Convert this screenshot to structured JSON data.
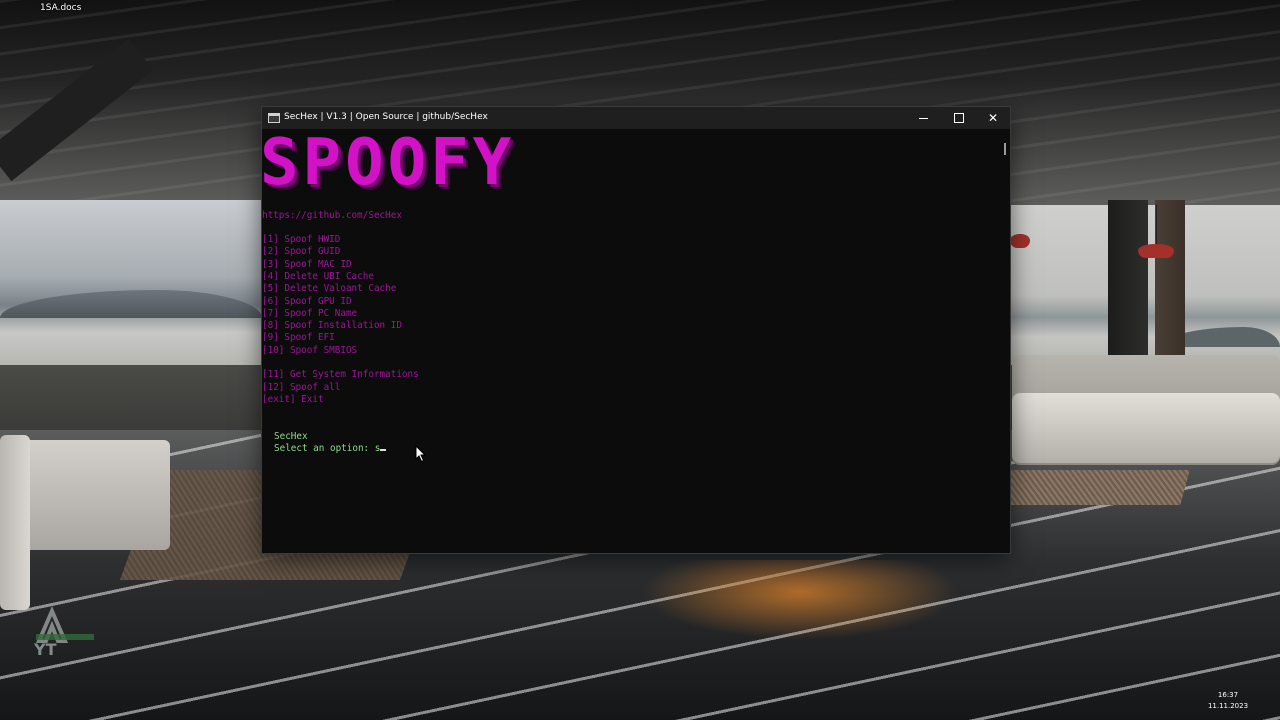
{
  "desktop": {
    "icon_label": "1SA.docs",
    "watermark_text": "YT"
  },
  "console": {
    "title": "SecHex | V1.3 | Open Source | github/SecHex",
    "banner": "SPOOFY",
    "url": "https://github.com/SecHex",
    "menu_items": [
      "[1] Spoof HWID",
      "[2] Spoof GUID",
      "[3] Spoof MAC ID",
      "[4] Delete UBI Cache",
      "[5] Delete Valoant Cache",
      "[6] Spoof GPU ID",
      "[7] Spoof PC Name",
      "[8] Spoof Installation ID",
      "[9] Spoof EFI",
      "[10] Spoof SMBIOS"
    ],
    "extra_items": [
      "[11] Get System Informations",
      "[12] Spoof all",
      "[exit] Exit"
    ],
    "prompt_name": "SecHex",
    "prompt_label": "Select an option: ",
    "prompt_value": "s",
    "colors": {
      "banner": "#d312c8",
      "menu_text": "#9f1499",
      "prompt_text": "#8fd98f",
      "background": "#0c0c0c"
    },
    "window_buttons": {
      "close_symbol": "✕"
    }
  },
  "taskbar": {
    "time": "16:37",
    "date": "11.11.2023"
  }
}
